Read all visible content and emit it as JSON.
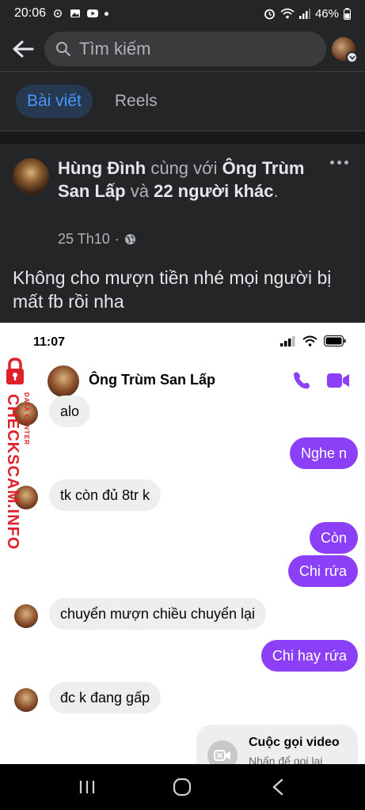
{
  "status_bar": {
    "time": "20:06",
    "battery": "46%"
  },
  "header": {
    "search_placeholder": "Tìm kiếm"
  },
  "tabs": [
    {
      "label": "Bài viết",
      "active": true
    },
    {
      "label": "Reels",
      "active": false
    }
  ],
  "post": {
    "author": "Hùng Đình",
    "with_word": "cùng với",
    "tagged": "Ông Trùm San Lấp",
    "and_word": "và",
    "others": "22 người khác",
    "time": "25 Th10",
    "text": "Không cho mượn tiền nhé mọi người bị mất fb rồi nha"
  },
  "screenshot": {
    "time": "11:07",
    "contact_name": "Ông Trùm San Lấp",
    "messages": [
      {
        "dir": "in",
        "text": "alo"
      },
      {
        "dir": "out",
        "text": "Nghe n"
      },
      {
        "dir": "in",
        "text": "tk còn đủ 8tr k"
      },
      {
        "dir": "out",
        "text": "Còn"
      },
      {
        "dir": "out",
        "text": "Chi rứa"
      },
      {
        "dir": "in",
        "text": "chuyển mượn chiều chuyển lại"
      },
      {
        "dir": "out",
        "text": "Chi hay rứa"
      },
      {
        "dir": "in",
        "text": "đc k đang gấp"
      }
    ],
    "call_card": {
      "title": "Cuộc gọi video",
      "subtitle": "Nhấn để gọi lại"
    }
  },
  "watermark": {
    "main": "CHECKSCAM.INFO",
    "sub": "DATA CENTER"
  },
  "colors": {
    "background": "#18191a",
    "surface": "#242526",
    "accent": "#4599ff",
    "messenger_purple": "#8b3ff7",
    "watermark_red": "#e0202a"
  }
}
